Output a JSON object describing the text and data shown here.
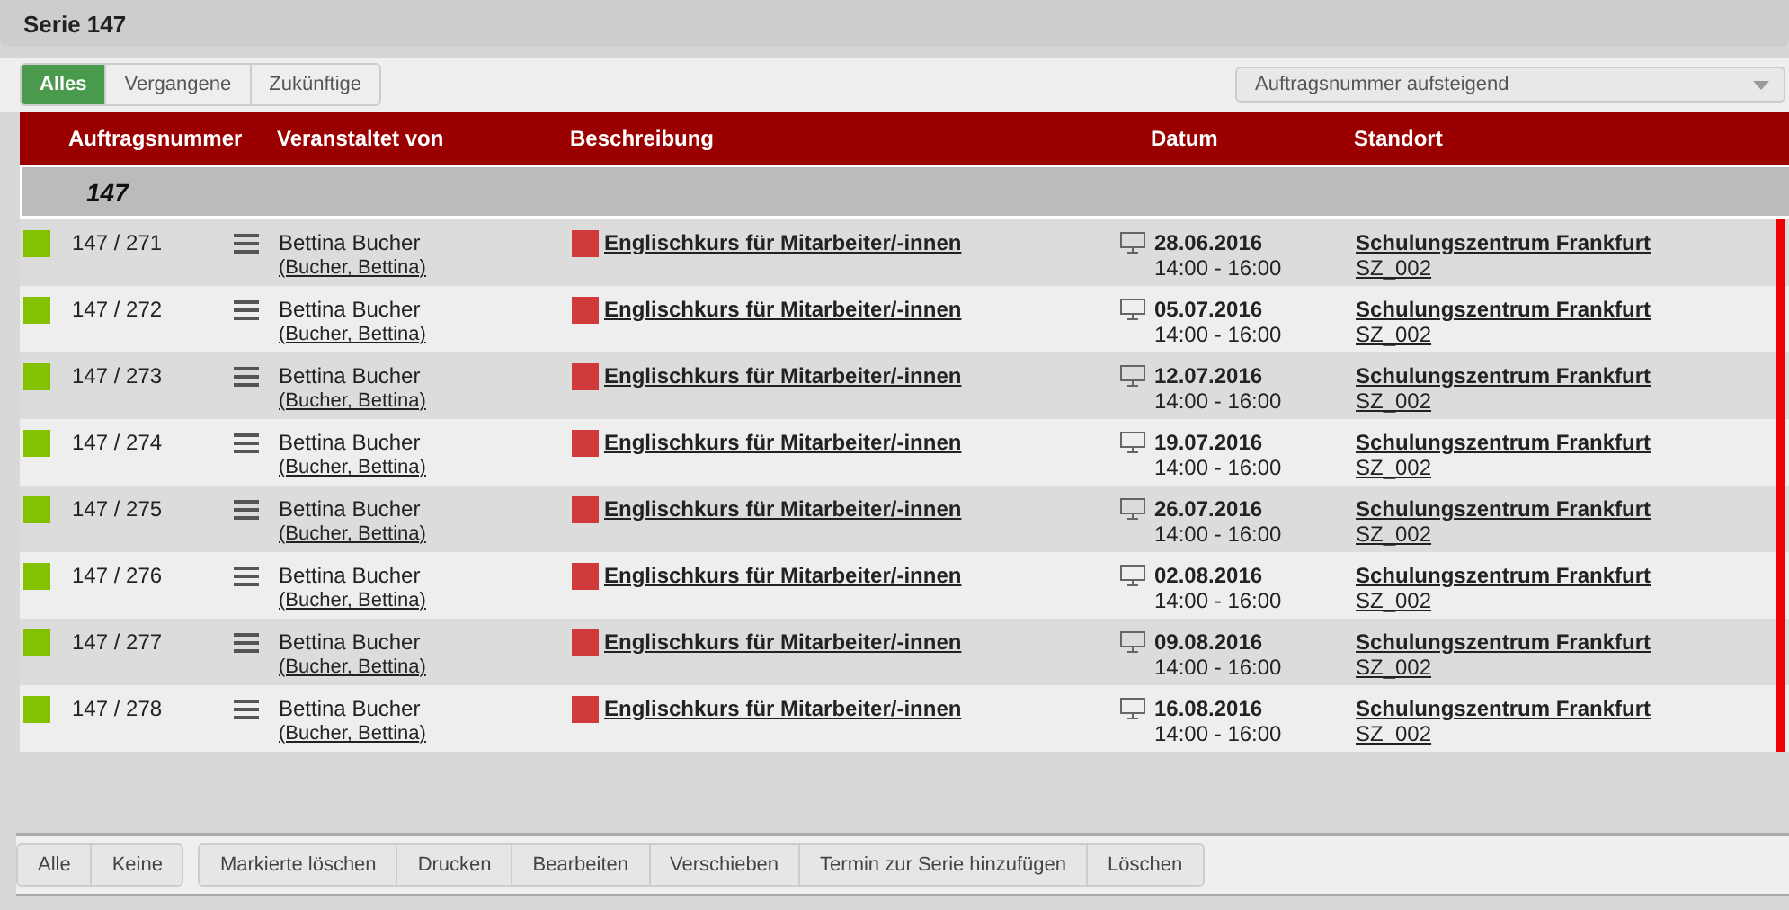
{
  "window": {
    "title": "Serie 147"
  },
  "filters": [
    {
      "label": "Alles",
      "selected": true
    },
    {
      "label": "Vergangene",
      "selected": false
    },
    {
      "label": "Zukünftige",
      "selected": false
    }
  ],
  "sort": {
    "value": "Auftragsnummer aufsteigend"
  },
  "table": {
    "columns": [
      "Auftragsnummer",
      "Veranstaltet von",
      "Beschreibung",
      "Datum",
      "Standort"
    ],
    "group": "147",
    "rows": [
      {
        "number": "147 / 271",
        "organizer": "Bettina Bucher",
        "organizer_link": "(Bucher, Bettina)",
        "description": "Englischkurs für Mitarbeiter/-innen",
        "date": "28.06.2016",
        "time": "14:00 - 16:00",
        "location": "Schulungszentrum Frankfurt",
        "room": "SZ_002"
      },
      {
        "number": "147 / 272",
        "organizer": "Bettina Bucher",
        "organizer_link": "(Bucher, Bettina)",
        "description": "Englischkurs für Mitarbeiter/-innen",
        "date": "05.07.2016",
        "time": "14:00 - 16:00",
        "location": "Schulungszentrum Frankfurt",
        "room": "SZ_002"
      },
      {
        "number": "147 / 273",
        "organizer": "Bettina Bucher",
        "organizer_link": "(Bucher, Bettina)",
        "description": "Englischkurs für Mitarbeiter/-innen",
        "date": "12.07.2016",
        "time": "14:00 - 16:00",
        "location": "Schulungszentrum Frankfurt",
        "room": "SZ_002"
      },
      {
        "number": "147 / 274",
        "organizer": "Bettina Bucher",
        "organizer_link": "(Bucher, Bettina)",
        "description": "Englischkurs für Mitarbeiter/-innen",
        "date": "19.07.2016",
        "time": "14:00 - 16:00",
        "location": "Schulungszentrum Frankfurt",
        "room": "SZ_002"
      },
      {
        "number": "147 / 275",
        "organizer": "Bettina Bucher",
        "organizer_link": "(Bucher, Bettina)",
        "description": "Englischkurs für Mitarbeiter/-innen",
        "date": "26.07.2016",
        "time": "14:00 - 16:00",
        "location": "Schulungszentrum Frankfurt",
        "room": "SZ_002"
      },
      {
        "number": "147 / 276",
        "organizer": "Bettina Bucher",
        "organizer_link": "(Bucher, Bettina)",
        "description": "Englischkurs für Mitarbeiter/-innen",
        "date": "02.08.2016",
        "time": "14:00 - 16:00",
        "location": "Schulungszentrum Frankfurt",
        "room": "SZ_002"
      },
      {
        "number": "147 / 277",
        "organizer": "Bettina Bucher",
        "organizer_link": "(Bucher, Bettina)",
        "description": "Englischkurs für Mitarbeiter/-innen",
        "date": "09.08.2016",
        "time": "14:00 - 16:00",
        "location": "Schulungszentrum Frankfurt",
        "room": "SZ_002"
      },
      {
        "number": "147 / 278",
        "organizer": "Bettina Bucher",
        "organizer_link": "(Bucher, Bettina)",
        "description": "Englischkurs für Mitarbeiter/-innen",
        "date": "16.08.2016",
        "time": "14:00 - 16:00",
        "location": "Schulungszentrum Frankfurt",
        "room": "SZ_002"
      }
    ]
  },
  "selection_buttons": [
    "Alle",
    "Keine"
  ],
  "action_buttons": [
    "Markierte löschen",
    "Drucken",
    "Bearbeiten",
    "Verschieben",
    "Termin zur Serie hinzufügen",
    "Löschen"
  ]
}
